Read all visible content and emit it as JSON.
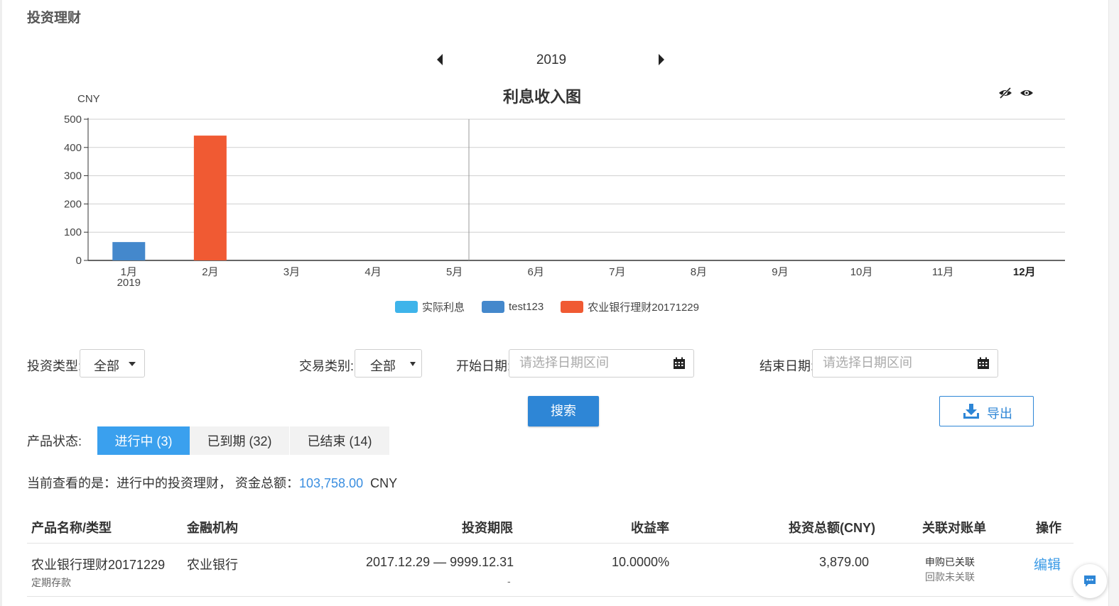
{
  "page": {
    "title": "投资理财"
  },
  "year_nav": {
    "year": "2019"
  },
  "chart": {
    "unit": "CNY",
    "title": "利息收入图",
    "legend": [
      {
        "label": "实际利息",
        "color": "#3eb4ea"
      },
      {
        "label": "test123",
        "color": "#4488cc"
      },
      {
        "label": "农业银行理财20171229",
        "color": "#f05a33"
      }
    ]
  },
  "chart_data": {
    "type": "bar",
    "title": "利息收入图",
    "ylabel": "CNY",
    "categories": [
      "1月",
      "2月",
      "3月",
      "4月",
      "5月",
      "6月",
      "7月",
      "8月",
      "9月",
      "10月",
      "11月",
      "12月"
    ],
    "first_category_sublabel": "2019",
    "yticks": [
      "0",
      "100",
      "200",
      "300",
      "400",
      "500"
    ],
    "ylim": [
      0,
      500
    ],
    "grid": true,
    "legend_position": "bottom",
    "series": [
      {
        "name": "实际利息",
        "color": "#3eb4ea",
        "values": [
          0,
          0,
          0,
          0,
          0,
          0,
          0,
          0,
          0,
          0,
          0,
          0
        ]
      },
      {
        "name": "test123",
        "color": "#4488cc",
        "values": [
          65,
          0,
          0,
          0,
          0,
          0,
          0,
          0,
          0,
          0,
          0,
          0
        ]
      },
      {
        "name": "农业银行理财20171229",
        "color": "#f05a33",
        "values": [
          0,
          442,
          0,
          0,
          0,
          0,
          0,
          0,
          0,
          0,
          0,
          0
        ]
      }
    ]
  },
  "filters": {
    "invest_type": {
      "label": "投资类型:",
      "value": "全部"
    },
    "trade_type": {
      "label": "交易类别:",
      "value": "全部"
    },
    "start_date": {
      "label": "开始日期:",
      "placeholder": "请选择日期区间"
    },
    "end_date": {
      "label": "结束日期:",
      "placeholder": "请选择日期区间"
    },
    "search_label": "搜索",
    "export_label": "导出"
  },
  "status": {
    "label": "产品状态:",
    "tabs": [
      {
        "label": "进行中 (3)"
      },
      {
        "label": "已到期 (32)"
      },
      {
        "label": "已结束 (14)"
      }
    ]
  },
  "summary": {
    "prefix": "当前查看的是：进行中的投资理财，  资金总额：",
    "amount": "103,758.00",
    "currency": "CNY"
  },
  "table": {
    "headers": [
      "产品名称/类型",
      "金融机构",
      "投资期限",
      "收益率",
      "投资总额(CNY)",
      "关联对账单",
      "操作"
    ],
    "rows": [
      {
        "name": "农业银行理财20171229",
        "type": "定期存款",
        "institution": "农业银行",
        "period": "2017.12.29 — 9999.12.31",
        "period_sub": "-",
        "rate": "10.0000%",
        "amount": "3,879.00",
        "bill_1": "申购已关联",
        "bill_2": "回款未关联",
        "action": "编辑"
      }
    ]
  }
}
